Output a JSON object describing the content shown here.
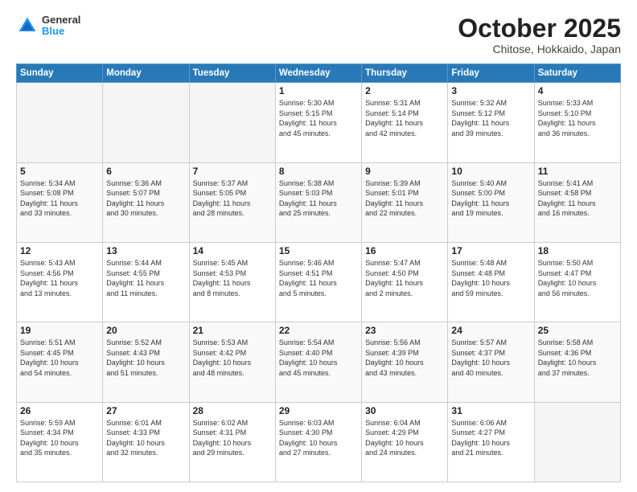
{
  "header": {
    "logo": {
      "general": "General",
      "blue": "Blue"
    },
    "title": "October 2025",
    "subtitle": "Chitose, Hokkaido, Japan"
  },
  "weekdays": [
    "Sunday",
    "Monday",
    "Tuesday",
    "Wednesday",
    "Thursday",
    "Friday",
    "Saturday"
  ],
  "weeks": [
    [
      {
        "day": "",
        "info": ""
      },
      {
        "day": "",
        "info": ""
      },
      {
        "day": "",
        "info": ""
      },
      {
        "day": "1",
        "info": "Sunrise: 5:30 AM\nSunset: 5:15 PM\nDaylight: 11 hours\nand 45 minutes."
      },
      {
        "day": "2",
        "info": "Sunrise: 5:31 AM\nSunset: 5:14 PM\nDaylight: 11 hours\nand 42 minutes."
      },
      {
        "day": "3",
        "info": "Sunrise: 5:32 AM\nSunset: 5:12 PM\nDaylight: 11 hours\nand 39 minutes."
      },
      {
        "day": "4",
        "info": "Sunrise: 5:33 AM\nSunset: 5:10 PM\nDaylight: 11 hours\nand 36 minutes."
      }
    ],
    [
      {
        "day": "5",
        "info": "Sunrise: 5:34 AM\nSunset: 5:08 PM\nDaylight: 11 hours\nand 33 minutes."
      },
      {
        "day": "6",
        "info": "Sunrise: 5:36 AM\nSunset: 5:07 PM\nDaylight: 11 hours\nand 30 minutes."
      },
      {
        "day": "7",
        "info": "Sunrise: 5:37 AM\nSunset: 5:05 PM\nDaylight: 11 hours\nand 28 minutes."
      },
      {
        "day": "8",
        "info": "Sunrise: 5:38 AM\nSunset: 5:03 PM\nDaylight: 11 hours\nand 25 minutes."
      },
      {
        "day": "9",
        "info": "Sunrise: 5:39 AM\nSunset: 5:01 PM\nDaylight: 11 hours\nand 22 minutes."
      },
      {
        "day": "10",
        "info": "Sunrise: 5:40 AM\nSunset: 5:00 PM\nDaylight: 11 hours\nand 19 minutes."
      },
      {
        "day": "11",
        "info": "Sunrise: 5:41 AM\nSunset: 4:58 PM\nDaylight: 11 hours\nand 16 minutes."
      }
    ],
    [
      {
        "day": "12",
        "info": "Sunrise: 5:43 AM\nSunset: 4:56 PM\nDaylight: 11 hours\nand 13 minutes."
      },
      {
        "day": "13",
        "info": "Sunrise: 5:44 AM\nSunset: 4:55 PM\nDaylight: 11 hours\nand 11 minutes."
      },
      {
        "day": "14",
        "info": "Sunrise: 5:45 AM\nSunset: 4:53 PM\nDaylight: 11 hours\nand 8 minutes."
      },
      {
        "day": "15",
        "info": "Sunrise: 5:46 AM\nSunset: 4:51 PM\nDaylight: 11 hours\nand 5 minutes."
      },
      {
        "day": "16",
        "info": "Sunrise: 5:47 AM\nSunset: 4:50 PM\nDaylight: 11 hours\nand 2 minutes."
      },
      {
        "day": "17",
        "info": "Sunrise: 5:48 AM\nSunset: 4:48 PM\nDaylight: 10 hours\nand 59 minutes."
      },
      {
        "day": "18",
        "info": "Sunrise: 5:50 AM\nSunset: 4:47 PM\nDaylight: 10 hours\nand 56 minutes."
      }
    ],
    [
      {
        "day": "19",
        "info": "Sunrise: 5:51 AM\nSunset: 4:45 PM\nDaylight: 10 hours\nand 54 minutes."
      },
      {
        "day": "20",
        "info": "Sunrise: 5:52 AM\nSunset: 4:43 PM\nDaylight: 10 hours\nand 51 minutes."
      },
      {
        "day": "21",
        "info": "Sunrise: 5:53 AM\nSunset: 4:42 PM\nDaylight: 10 hours\nand 48 minutes."
      },
      {
        "day": "22",
        "info": "Sunrise: 5:54 AM\nSunset: 4:40 PM\nDaylight: 10 hours\nand 45 minutes."
      },
      {
        "day": "23",
        "info": "Sunrise: 5:56 AM\nSunset: 4:39 PM\nDaylight: 10 hours\nand 43 minutes."
      },
      {
        "day": "24",
        "info": "Sunrise: 5:57 AM\nSunset: 4:37 PM\nDaylight: 10 hours\nand 40 minutes."
      },
      {
        "day": "25",
        "info": "Sunrise: 5:58 AM\nSunset: 4:36 PM\nDaylight: 10 hours\nand 37 minutes."
      }
    ],
    [
      {
        "day": "26",
        "info": "Sunrise: 5:59 AM\nSunset: 4:34 PM\nDaylight: 10 hours\nand 35 minutes."
      },
      {
        "day": "27",
        "info": "Sunrise: 6:01 AM\nSunset: 4:33 PM\nDaylight: 10 hours\nand 32 minutes."
      },
      {
        "day": "28",
        "info": "Sunrise: 6:02 AM\nSunset: 4:31 PM\nDaylight: 10 hours\nand 29 minutes."
      },
      {
        "day": "29",
        "info": "Sunrise: 6:03 AM\nSunset: 4:30 PM\nDaylight: 10 hours\nand 27 minutes."
      },
      {
        "day": "30",
        "info": "Sunrise: 6:04 AM\nSunset: 4:29 PM\nDaylight: 10 hours\nand 24 minutes."
      },
      {
        "day": "31",
        "info": "Sunrise: 6:06 AM\nSunset: 4:27 PM\nDaylight: 10 hours\nand 21 minutes."
      },
      {
        "day": "",
        "info": ""
      }
    ]
  ]
}
